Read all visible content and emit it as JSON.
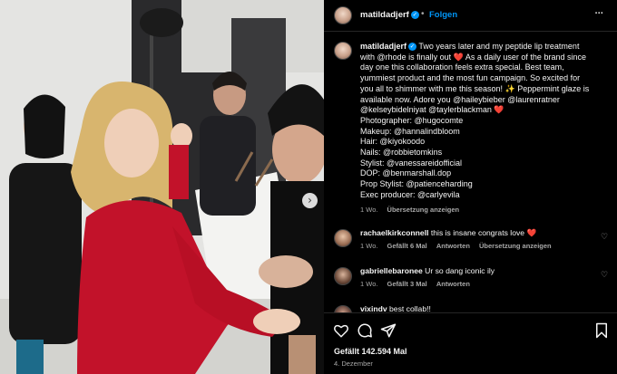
{
  "post_header": {
    "username": "matildadjerf",
    "separator": "•",
    "follow_label": "Folgen",
    "more_glyph": "···"
  },
  "caption": {
    "username": "matildadjerf",
    "lines": [
      " Two years later and my peptide lip treatment",
      "with @rhode is finally out ❤️ As a daily user of the brand since",
      "day one this collaboration feels extra special. Best team,",
      "yummiest product and the most fun campaign. So excited for",
      "you all to shimmer with me this season! ✨ Peppermint glaze is",
      "available now. Adore you @haileybieber @laurenratner",
      "@kelseybidelniyat @taylerblackman ❤️",
      "Photographer: @hugocomte",
      "Makeup: @hannalindbloom",
      "Hair: @kiyokoodo",
      "Nails: @robbietomkins",
      "Stylist: @vanessareidofficial",
      "DOP: @benmarshall.dop",
      "Prop Stylist: @patienceharding",
      "Exec producer: @carlyevila"
    ],
    "time": "1 Wo.",
    "translation_label": "Übersetzung anzeigen"
  },
  "comments": [
    {
      "username": "rachaelkirkconnell",
      "text": " this is insane congrats love ❤️",
      "time": "1 Wo.",
      "likes": "Gefällt 6 Mal",
      "reply_label": "Antworten",
      "translation_label": "Übersetzung anzeigen"
    },
    {
      "username": "gabriellebaronee",
      "text": " Ur so dang iconic ily",
      "time": "1 Wo.",
      "likes": "Gefällt 3 Mal",
      "reply_label": "Antworten"
    },
    {
      "username": "vixindv",
      "text": " best collab!!"
    }
  ],
  "actions": {
    "like_count": "Gefällt 142.594 Mal",
    "date": "4. Dezember"
  },
  "photo": {
    "next_glyph": "›"
  },
  "colors": {
    "accent": "#0095f6",
    "background": "#000000",
    "secondary_text": "#a8a8a8",
    "heart": "#ed4956"
  }
}
